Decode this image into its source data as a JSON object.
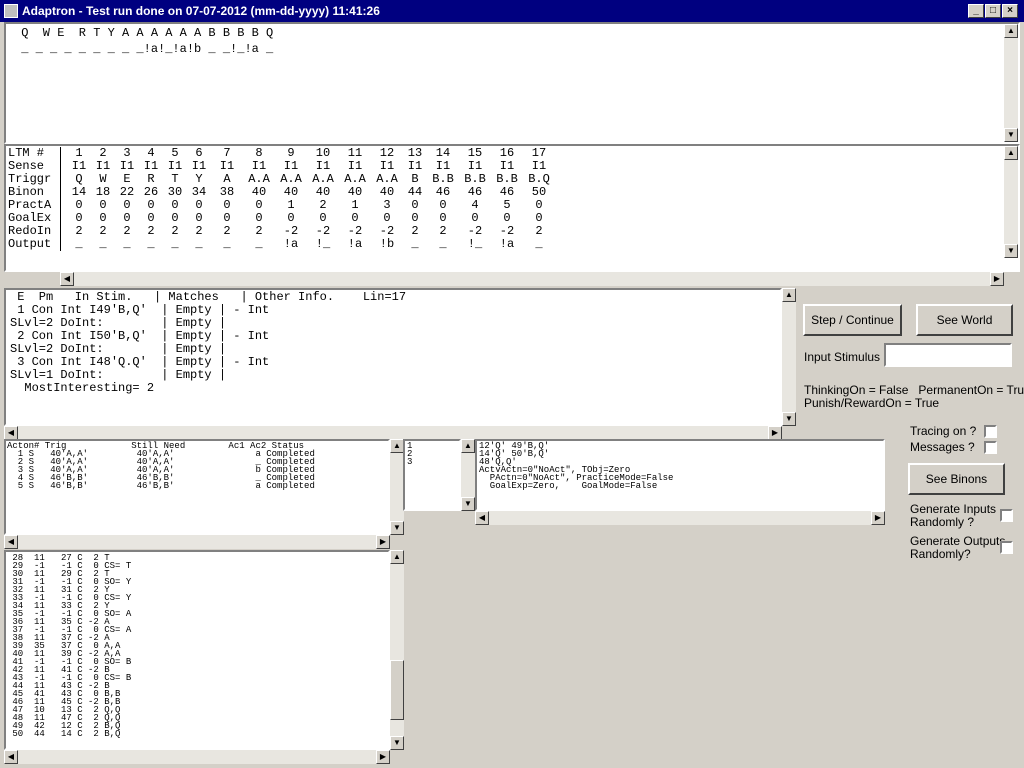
{
  "window": {
    "title": "Adaptron - Test run done on 07-07-2012 (mm-dd-yyyy) 11:41:26",
    "icons": {
      "app": "app-icon",
      "minimize": "minimize-icon",
      "maximize": "maximize-icon",
      "close": "close-icon"
    }
  },
  "world": {
    "line1": " Q  W E  R T Y A A A A A A B B B B Q",
    "line2": " _ _ _ _ _ _ _ _ _!a!_!a!b _ _!_!a _"
  },
  "ltm": {
    "headers": [
      "1",
      "2",
      "3",
      "4",
      "5",
      "6",
      "7",
      "8",
      "9",
      "10",
      "11",
      "12",
      "13",
      "14",
      "15",
      "16",
      "17"
    ],
    "rows": [
      {
        "label": "LTM #",
        "cells": [
          "1",
          "2",
          "3",
          "4",
          "5",
          "6",
          "7",
          "8",
          "9",
          "10",
          "11",
          "12",
          "13",
          "14",
          "15",
          "16",
          "17"
        ]
      },
      {
        "label": "Sense",
        "cells": [
          "I1",
          "I1",
          "I1",
          "I1",
          "I1",
          "I1",
          "I1",
          "I1",
          "I1",
          "I1",
          "I1",
          "I1",
          "I1",
          "I1",
          "I1",
          "I1",
          "I1"
        ]
      },
      {
        "label": "Triggr",
        "cells": [
          "Q",
          "W",
          "E",
          "R",
          "T",
          "Y",
          "A",
          "A.A",
          "A.A",
          "A.A",
          "A.A",
          "A.A",
          "B",
          "B.B",
          "B.B",
          "B.B",
          "B.Q"
        ]
      },
      {
        "label": "Binon",
        "cells": [
          "14",
          "18",
          "22",
          "26",
          "30",
          "34",
          "38",
          "40",
          "40",
          "40",
          "40",
          "40",
          "44",
          "46",
          "46",
          "46",
          "50"
        ]
      },
      {
        "label": "PractA",
        "cells": [
          "0",
          "0",
          "0",
          "0",
          "0",
          "0",
          "0",
          "0",
          "1",
          "2",
          "1",
          "3",
          "0",
          "0",
          "4",
          "5",
          "0"
        ]
      },
      {
        "label": "GoalEx",
        "cells": [
          "0",
          "0",
          "0",
          "0",
          "0",
          "0",
          "0",
          "0",
          "0",
          "0",
          "0",
          "0",
          "0",
          "0",
          "0",
          "0",
          "0"
        ]
      },
      {
        "label": "RedoIn",
        "cells": [
          "2",
          "2",
          "2",
          "2",
          "2",
          "2",
          "2",
          "2",
          "-2",
          "-2",
          "-2",
          "-2",
          "2",
          "2",
          "-2",
          "-2",
          "2"
        ]
      },
      {
        "label": "Output",
        "cells": [
          "_",
          "_",
          "_",
          "_",
          "_",
          "_",
          "_",
          "_",
          "!a",
          "!_",
          "!a",
          "!b",
          "_",
          "_",
          "!_",
          "!a",
          "_"
        ]
      }
    ]
  },
  "stm": {
    "lines": [
      " E  Pm   In Stim.   | Matches   | Other Info.    Lin=17",
      " 1 Con Int I49'B,Q'  | Empty | - Int",
      "SLvl=2 DoInt:        | Empty |",
      " 2 Con Int I50'B,Q'  | Empty | - Int",
      "SLvl=2 DoInt:        | Empty |",
      " 3 Con Int I48'Q.Q'  | Empty | - Int",
      "SLvl=1 DoInt:        | Empty |",
      "  MostInteresting= 2"
    ]
  },
  "controls": {
    "step_label": "Step / Continue",
    "see_world_label": "See World",
    "input_stimulus_label": "Input Stimulus :",
    "input_stimulus_value": "",
    "status_line1": "ThinkingOn = False   PermanentOn = True",
    "status_line2": "Punish/RewardOn = True",
    "tracing_label": "Tracing on ?",
    "messages_label": "Messages ?",
    "see_binons_label": "See Binons",
    "gen_inputs_label": "Generate Inputs\nRandomly ?",
    "gen_outputs_label": "Generate Outputs\nRandomly?"
  },
  "actons": {
    "lines": [
      "Acton# Trig            Still Need        Ac1 Ac2 Status",
      "  1 S   40'A,A'         40'A,A'               a Completed",
      "  2 S   40'A,A'         40'A,A'               _ Completed",
      "  3 S   40'A,A'         40'A,A'               b Completed",
      "  4 S   46'B,B'         46'B,B'               _ Completed",
      "  5 S   46'B,B'         46'B,B'               a Completed"
    ]
  },
  "small_list": {
    "lines": [
      "1",
      "2",
      "3"
    ]
  },
  "goal_info": {
    "lines": [
      "12'Q' 49'B,Q'",
      "14'Q' 50'B,Q'",
      "48'Q,Q'",
      "ActvActn=0\"NoAct\", TObj=Zero",
      "  PActn=0\"NoAct\", PracticeMode=False",
      "  GoalExp=Zero,    GoalMode=False"
    ]
  },
  "history": {
    "lines": [
      " 28  11   27 C  2 T",
      " 29  -1   -1 C  0 CS= T",
      " 30  11   29 C  2 T",
      " 31  -1   -1 C  0 SO= Y",
      " 32  11   31 C  2 Y",
      " 33  -1   -1 C  0 CS= Y",
      " 34  11   33 C  2 Y",
      " 35  -1   -1 C  0 SO= A",
      " 36  11   35 C -2 A",
      " 37  -1   -1 C  0 CS= A",
      " 38  11   37 C -2 A",
      " 39  35   37 C  0 A,A",
      " 40  11   39 C -2 A,A",
      " 41  -1   -1 C  0 SO= B",
      " 42  11   41 C -2 B",
      " 43  -1   -1 C  0 CS= B",
      " 44  11   43 C -2 B",
      " 45  41   43 C  0 B,B",
      " 46  11   45 C -2 B,B",
      " 47  10   13 C  2 Q,Q",
      " 48  11   47 C  2 Q,Q",
      " 49  42   12 C  2 B,Q",
      " 50  44   14 C  2 B,Q"
    ]
  }
}
